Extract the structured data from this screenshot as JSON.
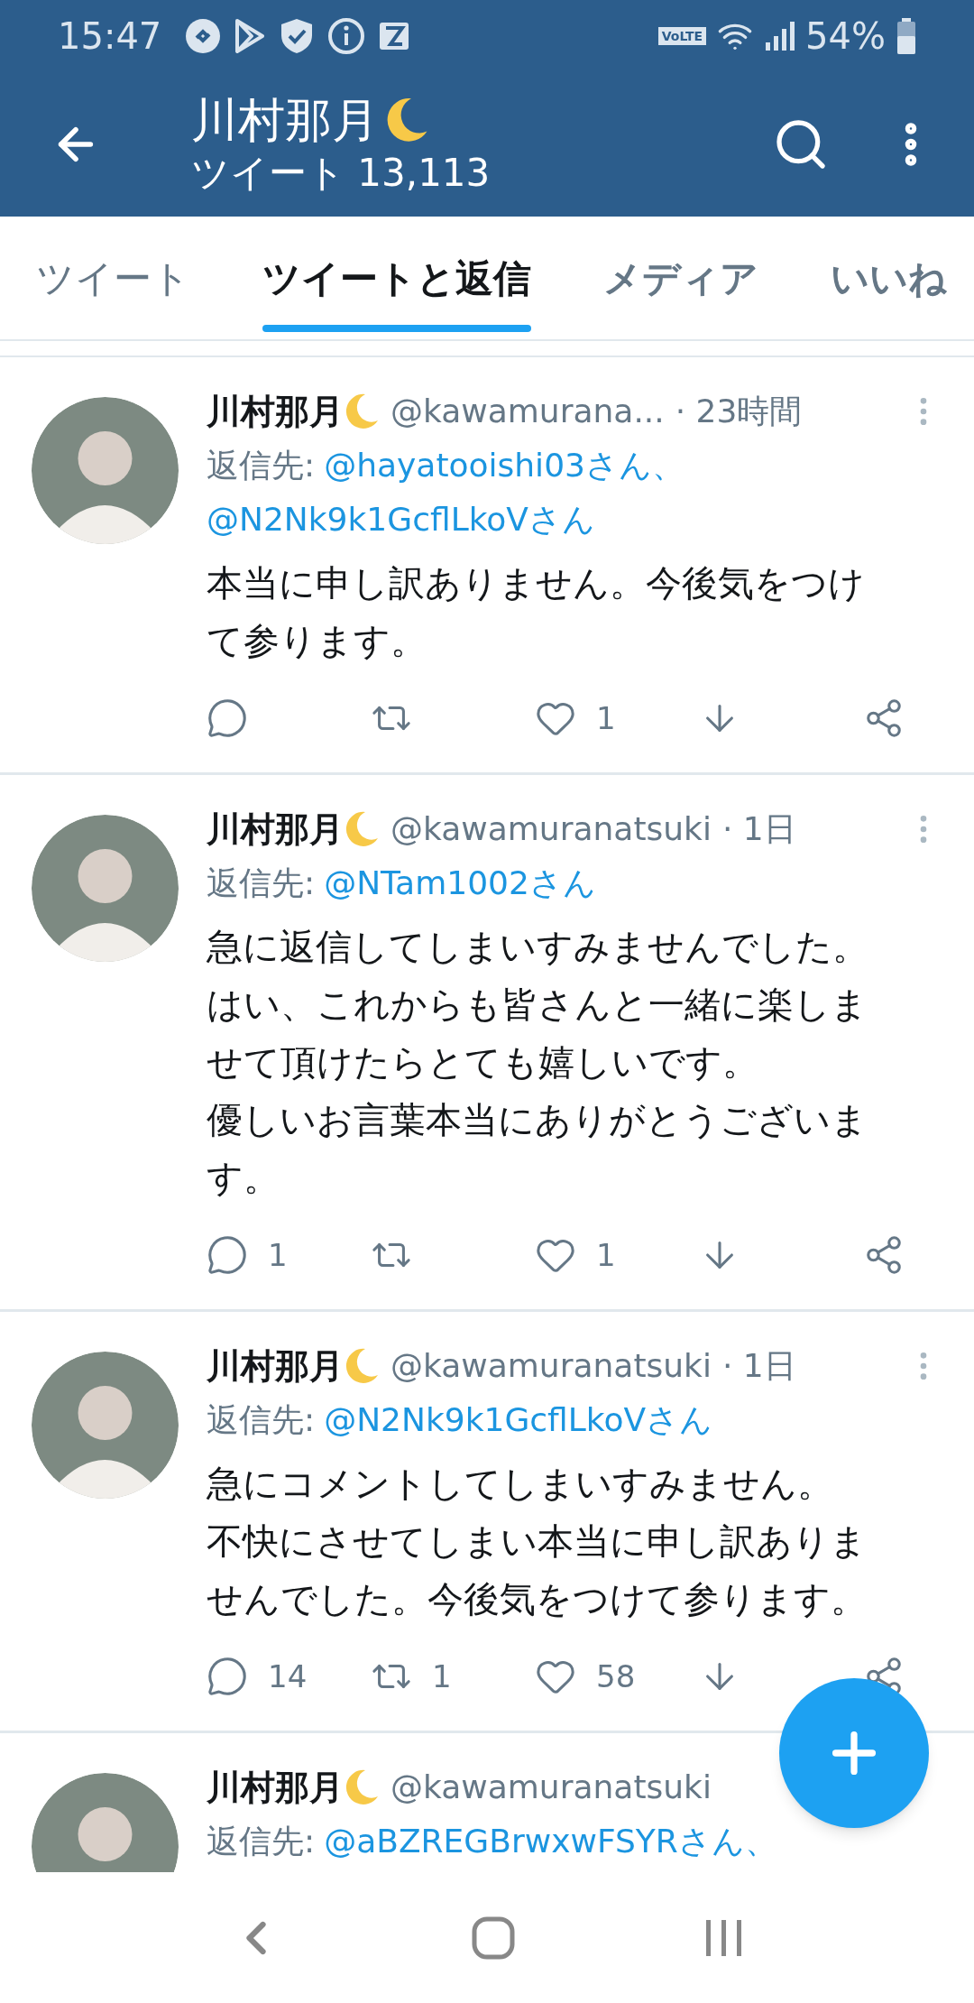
{
  "status_bar": {
    "time": "15:47",
    "volte": "VoLTE",
    "battery": "54%"
  },
  "header": {
    "title": "川村那月",
    "subtitle": "ツイート 13,113"
  },
  "tabs": [
    {
      "label": "ツイート",
      "selected": false
    },
    {
      "label": "ツイートと返信",
      "selected": true
    },
    {
      "label": "メディア",
      "selected": false
    },
    {
      "label": "いいね",
      "selected": false
    }
  ],
  "tweets": [
    {
      "name": "川村那月",
      "handle": "@kawamurana...",
      "time": "· 23時間",
      "reply_label": "返信先:",
      "reply_to": [
        "@hayatooishi03さん、",
        "@N2Nk9k1GcflLkoVさん"
      ],
      "body": [
        "本当に申し訳ありません。今後気をつけて参ります。"
      ],
      "likes": "1"
    },
    {
      "name": "川村那月",
      "handle": "@kawamuranatsuki",
      "time": "· 1日",
      "reply_label": "返信先:",
      "reply_to": [
        "@NTam1002さん"
      ],
      "body": [
        "急に返信してしまいすみませんでした。",
        "はい、これからも皆さんと一緒に楽しませて頂けたらとても嬉しいです。",
        "優しいお言葉本当にありがとうございます。"
      ],
      "replies": "1",
      "likes": "1"
    },
    {
      "name": "川村那月",
      "handle": "@kawamuranatsuki",
      "time": "· 1日",
      "reply_label": "返信先:",
      "reply_to": [
        "@N2Nk9k1GcflLkoVさん"
      ],
      "body": [
        "急にコメントしてしまいすみません。",
        "不快にさせてしまい本当に申し訳ありませんでした。今後気をつけて参ります。"
      ],
      "replies": "14",
      "retweets": "1",
      "likes": "58"
    },
    {
      "name": "川村那月",
      "handle": "@kawamuranatsuki",
      "reply_label": "返信先:",
      "reply_to": [
        "@aBZREGBrwxwFSYRさん、"
      ]
    }
  ]
}
